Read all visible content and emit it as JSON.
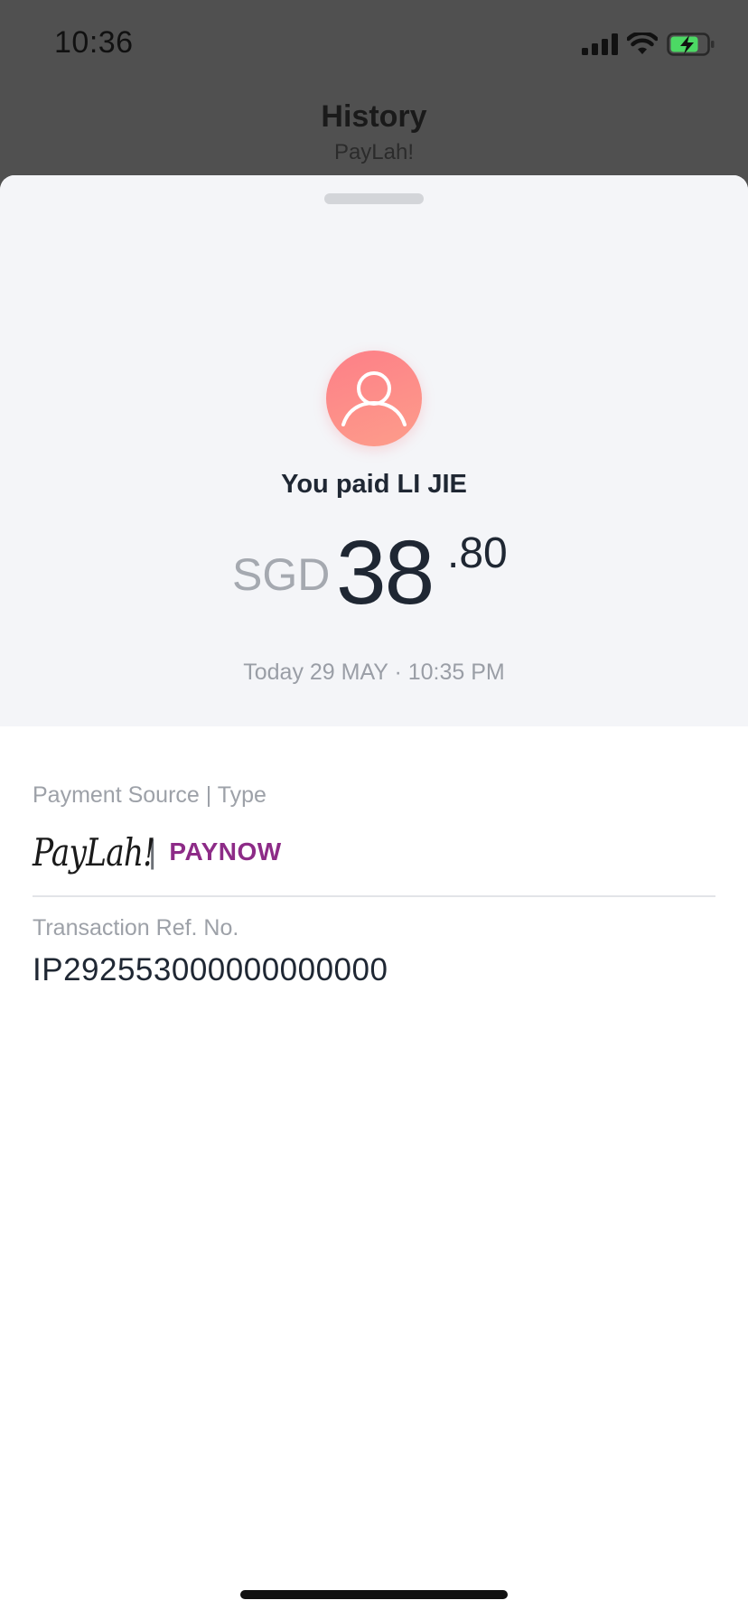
{
  "status_bar": {
    "time": "10:36"
  },
  "header": {
    "title": "History",
    "subtitle": "PayLah!"
  },
  "receipt": {
    "paid_to": "You paid LI JIE",
    "currency": "SGD",
    "amount_integer": "38",
    "amount_decimal": ".80",
    "datetime": "Today 29 MAY · 10:35 PM"
  },
  "details": {
    "payment_source_label": "Payment Source | Type",
    "source_logo_text": "PayLah!",
    "separator": "|",
    "type_logo_text": "PAYNOW",
    "ref_label": "Transaction Ref. No.",
    "ref_value": "IP292553000000000000"
  },
  "colors": {
    "avatar": "#fd8a89",
    "paynow": "#8d2b87",
    "battery": "#4cd964"
  }
}
